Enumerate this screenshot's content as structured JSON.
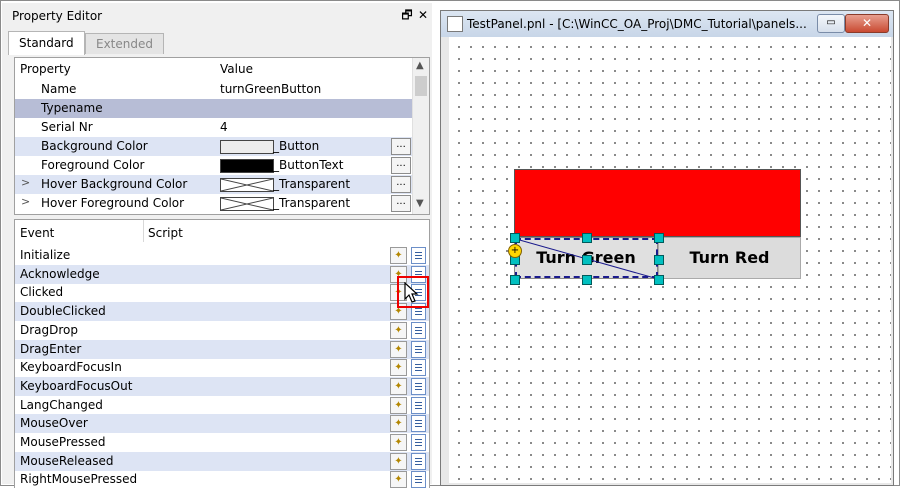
{
  "property_editor": {
    "title": "Property Editor",
    "restore_glyph": "🗗",
    "close_glyph": "✕",
    "tabs": [
      {
        "label": "Standard"
      },
      {
        "label": "Extended"
      }
    ],
    "headers": {
      "property": "Property",
      "value": "Value"
    },
    "rows": [
      {
        "name": "Name",
        "value": "turnGreenButton"
      },
      {
        "name": "Typename",
        "value": ""
      },
      {
        "name": "Serial Nr",
        "value": "4"
      },
      {
        "name": "Background Color",
        "value": "_Button",
        "swatch": "#ececec"
      },
      {
        "name": "Foreground Color",
        "value": "_ButtonText",
        "swatch": "#000000"
      },
      {
        "name": "Hover Background Color",
        "value": "_Transparent",
        "swatch": "transparent"
      },
      {
        "name": "Hover Foreground Color",
        "value": "_Transparent",
        "swatch": "transparent"
      }
    ],
    "dots_label": "...",
    "events_headers": {
      "event": "Event",
      "script": "Script"
    },
    "events": [
      "Initialize",
      "Acknowledge",
      "Clicked",
      "DoubleClicked",
      "DragDrop",
      "DragEnter",
      "KeyboardFocusIn",
      "KeyboardFocusOut",
      "LangChanged",
      "MouseOver",
      "MousePressed",
      "MouseReleased",
      "RightMousePressed"
    ]
  },
  "panel_window": {
    "title": "TestPanel.pnl - [C:\\WinCC_OA_Proj\\DMC_Tutorial\\panels...",
    "min_glyph": "▭",
    "close_glyph": "✕",
    "button_green_label": "Turn Green",
    "button_red_label": "Turn Red",
    "red_color": "#ff0000",
    "selection_color": "#1a1a8c",
    "handle_color": "#00c0c0"
  },
  "icons": {
    "wand": "wand-icon",
    "script": "script-editor-icon",
    "cursor": "mouse-cursor-icon"
  }
}
